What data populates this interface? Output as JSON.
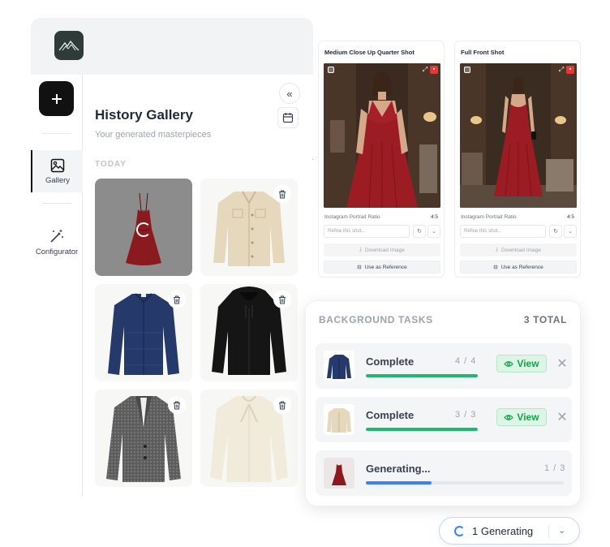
{
  "sidebar": {
    "logo": "mountain-logo",
    "new_button": "+",
    "items": [
      {
        "label": "Gallery",
        "icon": "image-icon",
        "active": true
      },
      {
        "label": "Configurator",
        "icon": "magic-wand-icon",
        "active": false
      }
    ]
  },
  "gallery": {
    "title": "History Gallery",
    "subtitle": "Your generated masterpieces",
    "section": "TODAY",
    "collapse": "«",
    "items": [
      {
        "item": "red gown",
        "state": "loading"
      },
      {
        "item": "beige jacket",
        "state": "done"
      },
      {
        "item": "navy cardigan",
        "state": "done"
      },
      {
        "item": "black hoodie",
        "state": "done"
      },
      {
        "item": "grey tweed blazer",
        "state": "done"
      },
      {
        "item": "cream blouse",
        "state": "done"
      }
    ]
  },
  "shots": [
    {
      "title": "Medium Close Up Quarter Shot",
      "ratio_label": "Instagram Portrait Ratio",
      "ratio_value": "4:5",
      "refine_placeholder": "Refine this shot...",
      "download_label": "Download Image",
      "reference_label": "Use as Reference"
    },
    {
      "title": "Full Front Shot",
      "ratio_label": "Instagram Portrait Ratio",
      "ratio_value": "4:5",
      "refine_placeholder": "Refine this shot...",
      "download_label": "Download Image",
      "reference_label": "Use as Reference"
    }
  ],
  "tasks": {
    "header": "BACKGROUND TASKS",
    "total": "3 TOTAL",
    "view_label": "View",
    "items": [
      {
        "status": "Complete",
        "count": "4 / 4",
        "progress": 1.0,
        "color": "#22b573",
        "thumb": "navy cardigan"
      },
      {
        "status": "Complete",
        "count": "3 / 3",
        "progress": 1.0,
        "color": "#22b573",
        "thumb": "beige jacket"
      },
      {
        "status": "Generating...",
        "count": "1 / 3",
        "progress": 0.33,
        "color": "#3b82f6",
        "thumb": "red gown"
      }
    ]
  },
  "generating_pill": {
    "label": "1 Generating"
  }
}
